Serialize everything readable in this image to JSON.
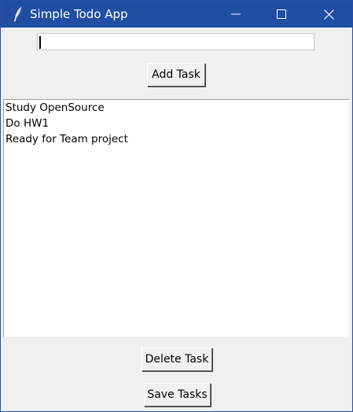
{
  "window": {
    "title": "Simple Todo App",
    "icon": "feather-icon",
    "controls": [
      "minimize-icon",
      "maximize-icon",
      "close-icon"
    ]
  },
  "input": {
    "value": "",
    "placeholder": ""
  },
  "buttons": {
    "add": "Add Task",
    "delete": "Delete Task",
    "save": "Save Tasks"
  },
  "tasks": [
    "Study OpenSource",
    "Do HW1",
    "Ready for Team project"
  ],
  "colors": {
    "titlebar": "#1f4ea3",
    "window_bg": "#f0f0f0",
    "list_bg": "#ffffff"
  }
}
